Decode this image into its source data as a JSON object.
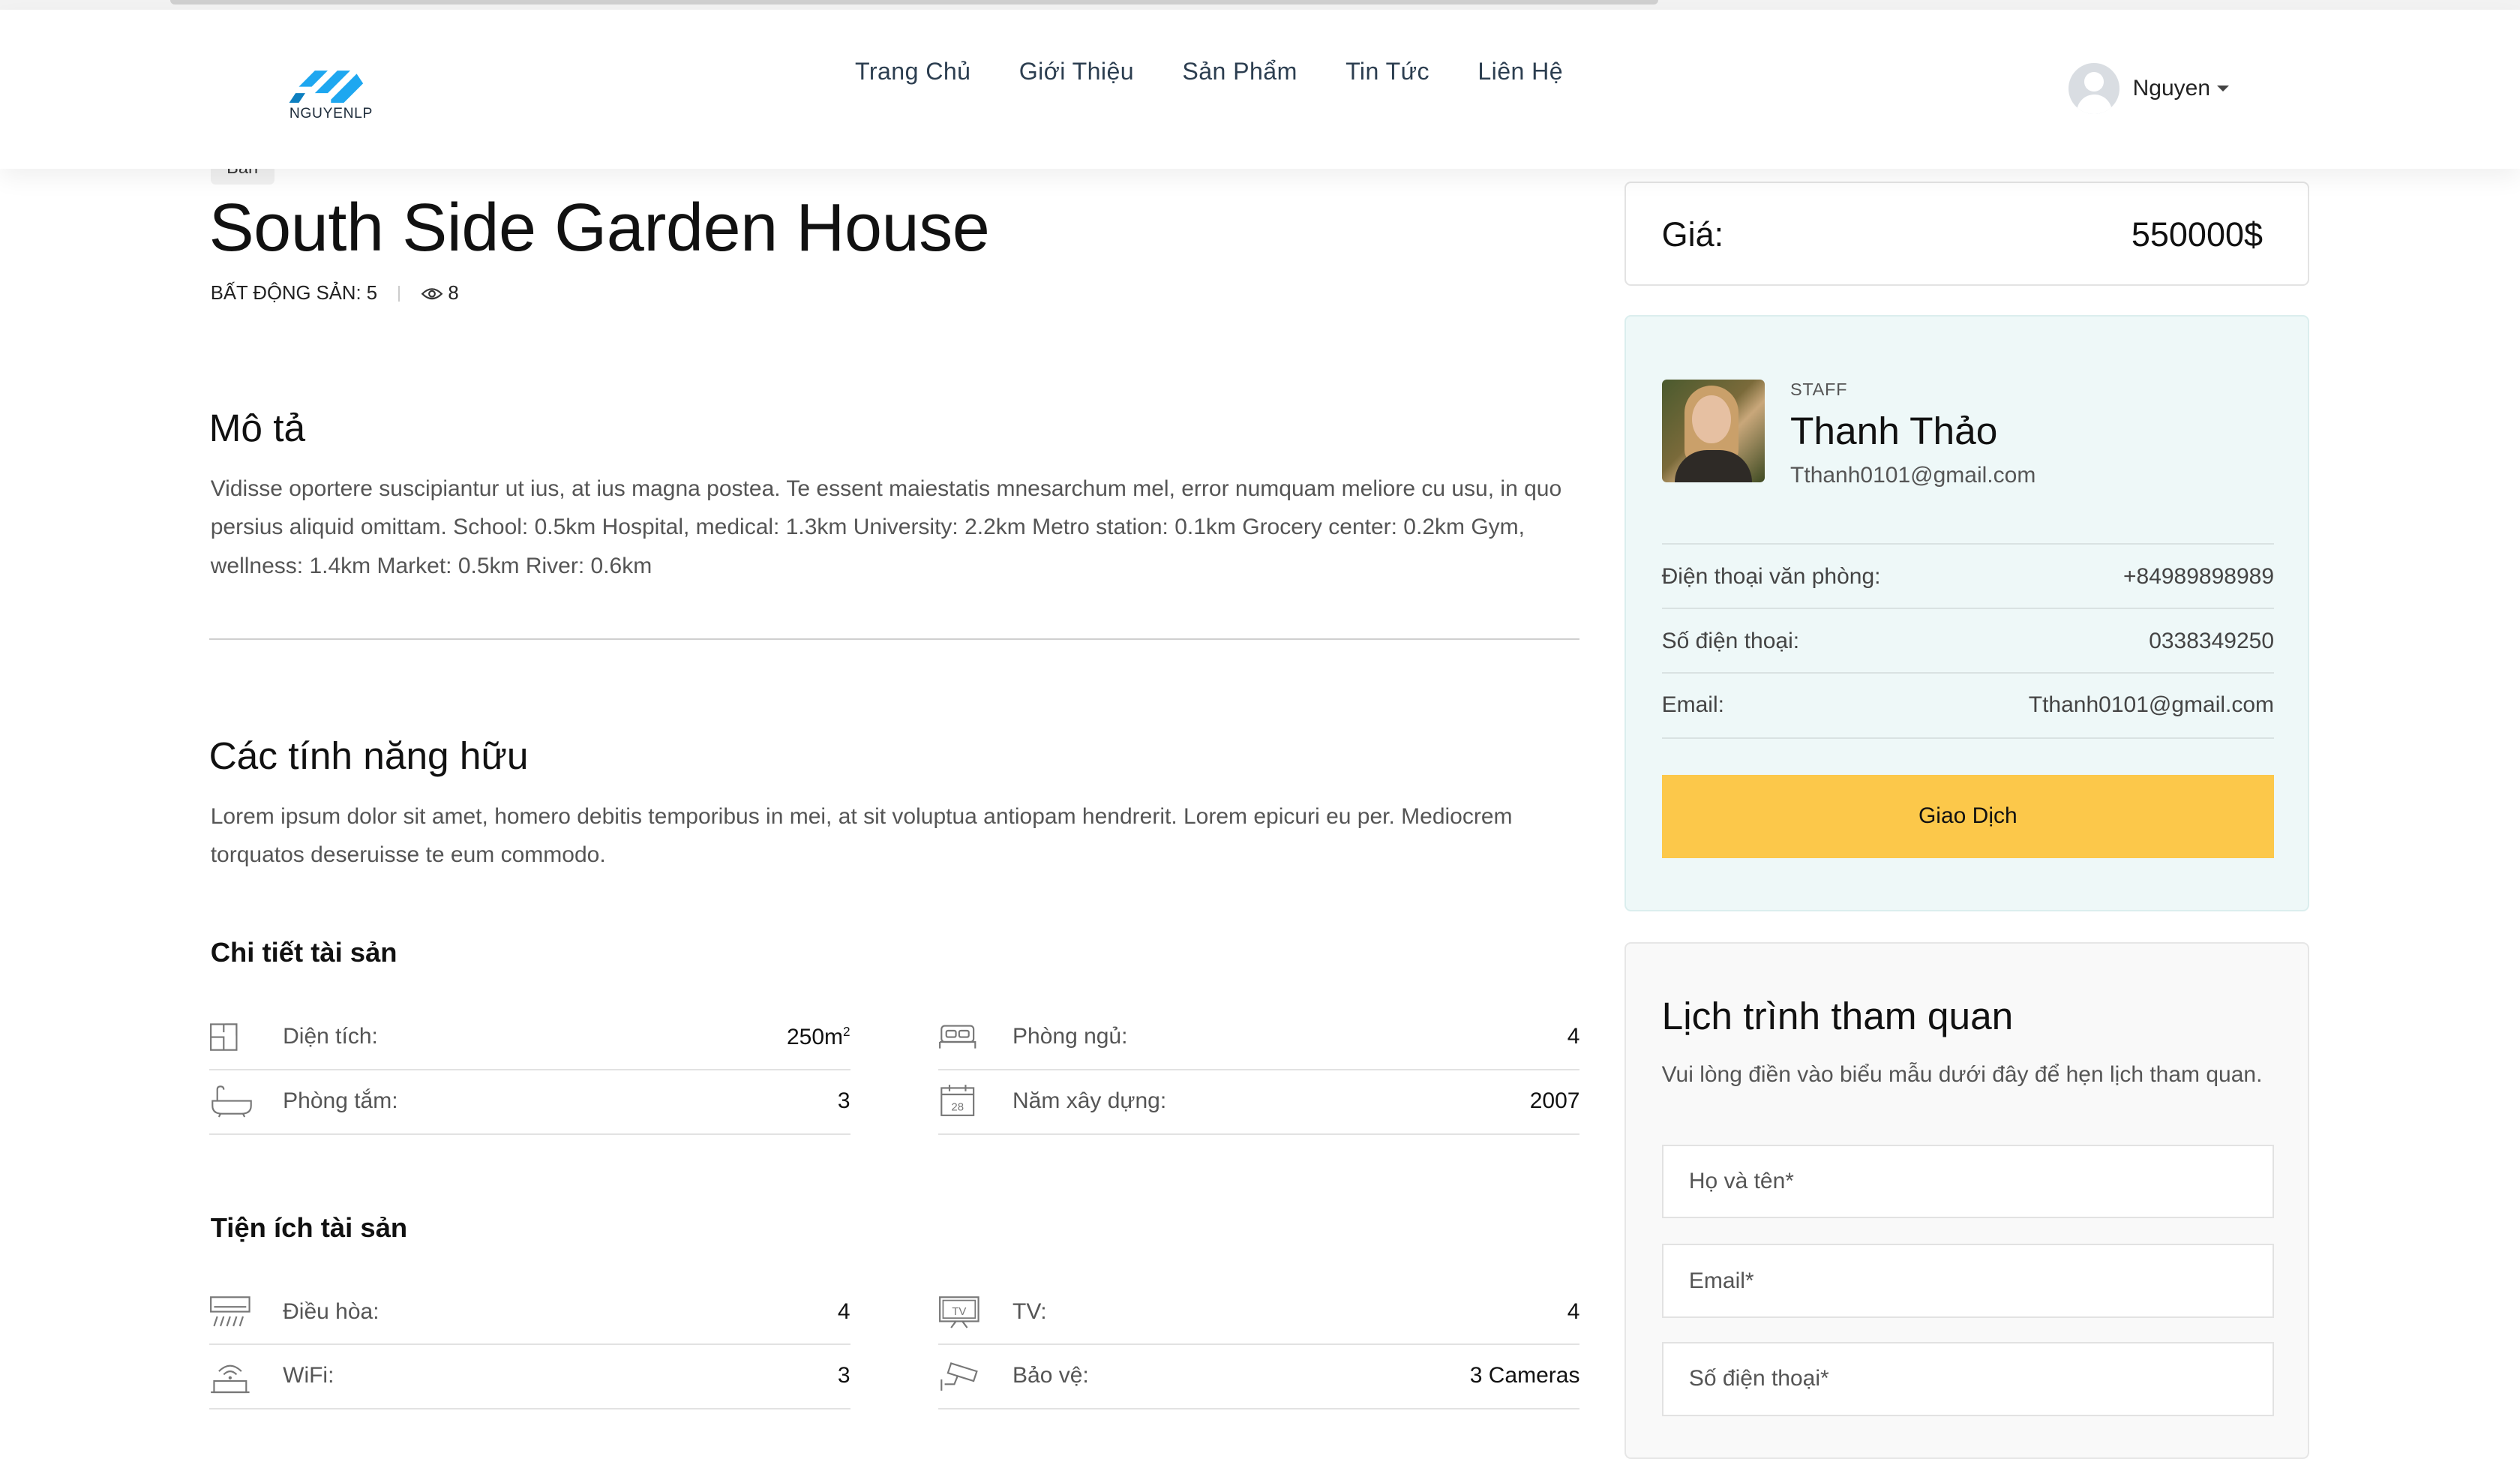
{
  "header": {
    "logo_text": "NGUYENLP",
    "nav": [
      "Trang Chủ",
      "Giới Thiệu",
      "Sản Phẩm",
      "Tin Tức",
      "Liên Hệ"
    ],
    "user_name": "Nguyen"
  },
  "listing": {
    "badge": "Bán",
    "title": "South Side Garden House",
    "category": "BẤT ĐỘNG SẢN: 5",
    "views": "8"
  },
  "description": {
    "heading": "Mô tả",
    "text": "Vidisse oportere suscipiantur ut ius, at ius magna postea. Te essent maiestatis mnesarchum mel, error numquam meliore cu usu, in quo persius aliquid omittam. School: 0.5km Hospital, medical: 1.3km University: 2.2km Metro station: 0.1km Grocery center: 0.2km Gym, wellness: 1.4km Market: 0.5km River: 0.6km"
  },
  "features": {
    "heading": "Các tính năng hữu",
    "text": "Lorem ipsum dolor sit amet, homero debitis temporibus in mei, at sit voluptua antiopam hendrerit. Lorem epicuri eu per. Mediocrem torquatos deseruisse te eum commodo."
  },
  "details": {
    "heading": "Chi tiết tài sản",
    "area_label": "Diện tích:",
    "area_value": "250m",
    "area_unit_sup": "2",
    "bedrooms_label": "Phòng ngủ:",
    "bedrooms_value": "4",
    "bathrooms_label": "Phòng tắm:",
    "bathrooms_value": "3",
    "year_label": "Năm xây dựng:",
    "year_value": "2007",
    "icons": [
      "area-icon",
      "bed-icon",
      "bathtub-icon",
      "calendar-icon"
    ]
  },
  "amenities": {
    "heading": "Tiện ích tài sản",
    "ac_label": "Điều hòa:",
    "ac_value": "4",
    "tv_label": "TV:",
    "tv_value": "4",
    "wifi_label": "WiFi:",
    "wifi_value": "3",
    "security_label": "Bảo vệ:",
    "security_value": "3 Cameras",
    "icons": [
      "air-conditioner-icon",
      "tv-icon",
      "wifi-router-icon",
      "security-camera-icon"
    ]
  },
  "price": {
    "label": "Giá:",
    "value": "550000$"
  },
  "agent": {
    "role": "STAFF",
    "name": "Thanh Thảo",
    "email": "Tthanh0101@gmail.com",
    "office_phone_label": "Điện thoại văn phòng:",
    "office_phone": "+84989898989",
    "phone_label": "Số điện thoại:",
    "phone": "0338349250",
    "email_label": "Email:",
    "email_value": "Tthanh0101@gmail.com",
    "button": "Giao Dịch"
  },
  "tour": {
    "heading": "Lịch trình tham quan",
    "text": "Vui lòng điền vào biểu mẫu dưới đây để hẹn lịch tham quan.",
    "name_placeholder": "Họ và tên*",
    "email_placeholder": "Email*",
    "phone_placeholder": "Số điện thoại*"
  },
  "colors": {
    "accent_button": "#fcc84a",
    "agent_panel_bg": "#eef8f8",
    "logo_blue": "#1ea7f0"
  }
}
